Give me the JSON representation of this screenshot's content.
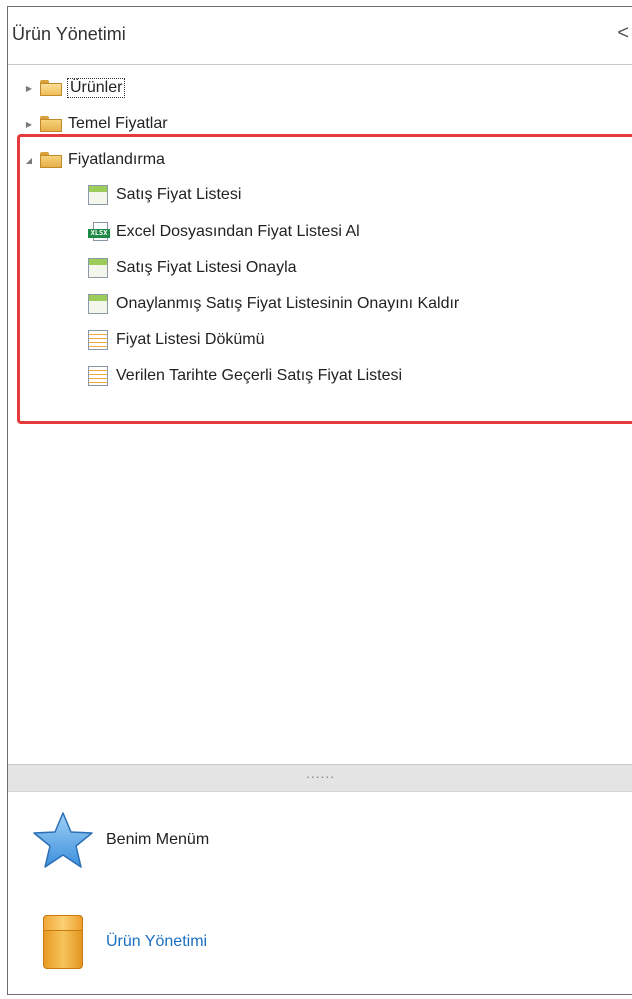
{
  "header": {
    "title": "Ürün Yönetimi",
    "collapse_glyph": "<"
  },
  "tree": {
    "folders": [
      {
        "label": "Ürünler",
        "expanded": false,
        "focused": true
      },
      {
        "label": "Temel Fiyatlar",
        "expanded": false
      },
      {
        "label": "Fiyatlandırma",
        "expanded": true
      }
    ],
    "items": [
      {
        "label": "Satış Fiyat Listesi",
        "icon": "grid-icon"
      },
      {
        "label": "Excel Dosyasından Fiyat Listesi Al",
        "icon": "xlsx-icon"
      },
      {
        "label": "Satış Fiyat Listesi Onayla",
        "icon": "grid-icon"
      },
      {
        "label": "Onaylanmış Satış Fiyat Listesinin Onayını Kaldır",
        "icon": "grid-icon"
      },
      {
        "label": "Fiyat Listesi Dökümü",
        "icon": "document-icon"
      },
      {
        "label": "Verilen Tarihte Geçerli Satış Fiyat Listesi",
        "icon": "document-icon"
      }
    ],
    "xlsx_badge": "XLSX"
  },
  "splitter": {
    "grip": "......"
  },
  "bottom_nav": [
    {
      "label": "Benim Menüm",
      "icon": "star-icon"
    },
    {
      "label": "Ürün Yönetimi",
      "icon": "box-icon",
      "active": true
    }
  ],
  "colors": {
    "highlight": "#e63b3b",
    "active_link": "#1a6fc2",
    "splitter_bg": "#e4e4e4"
  }
}
